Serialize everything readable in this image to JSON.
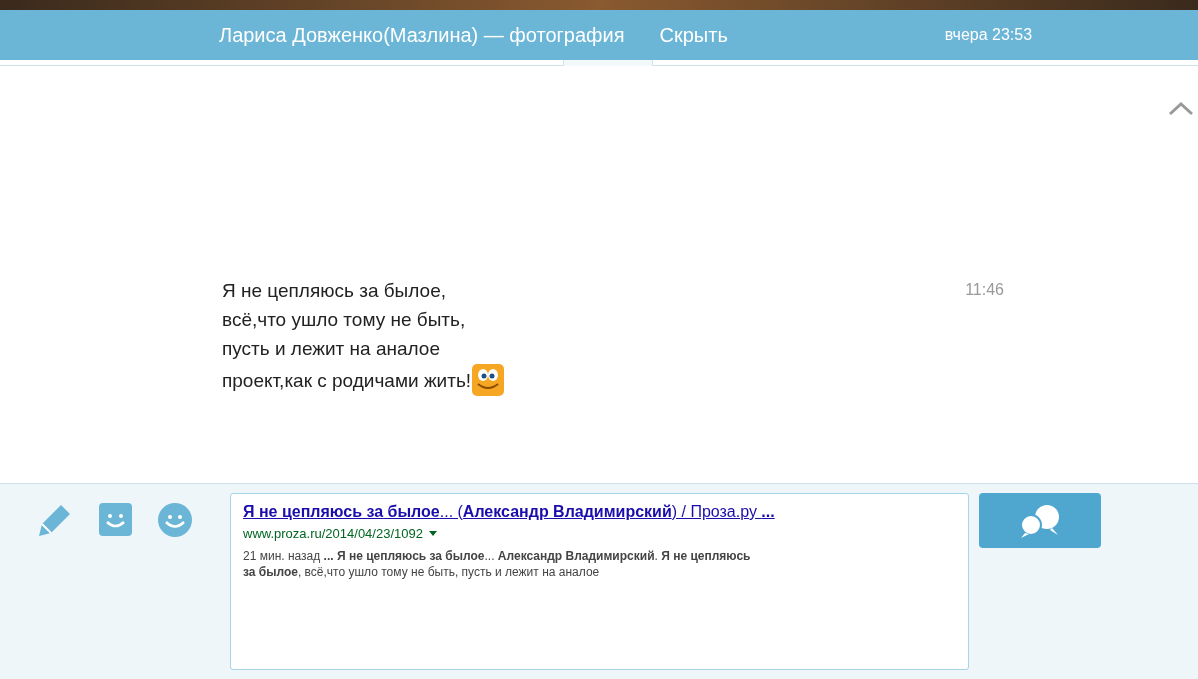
{
  "header": {
    "title": "Лариса Довженко(Мазлина) — фотография",
    "hide_link": "Скрыть",
    "time": "вчера 23:53"
  },
  "message": {
    "lines": [
      "Я не цепляюсь за былое,",
      "всё,что ушло тому не быть,",
      "пусть и лежит на аналое",
      "проект,как с родичами жить!"
    ],
    "time": "11:46"
  },
  "composer": {
    "title_link": "**Я не цепляюсь за былое**... (**Александр Владимирский**) / Проза.ру **...**",
    "url": "www.proza.ru/2014/04/23/1092",
    "snippet": "21 мин. назад **... Я не цепляюсь за былое**... **Александр Владимирский**. **Я не цепляюсь за былое**, всё,что ушло тому не быть, пусть и лежит на аналое"
  }
}
